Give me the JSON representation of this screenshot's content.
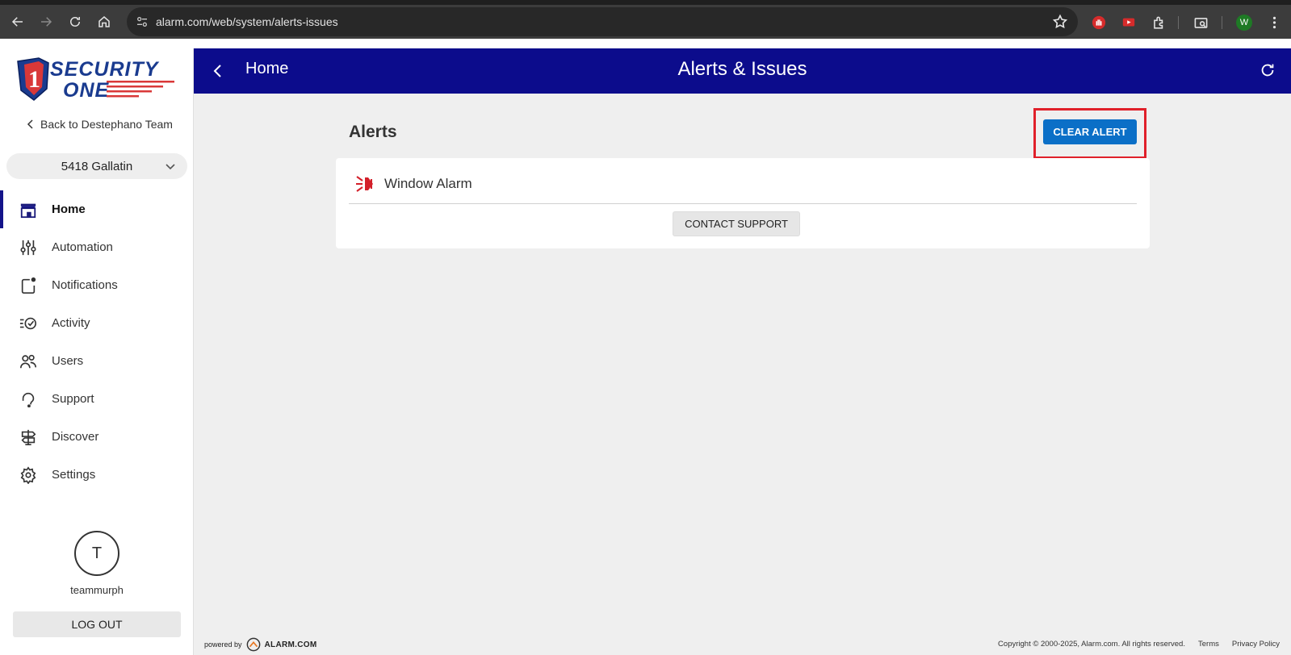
{
  "browser": {
    "url": "alarm.com/web/system/alerts-issues",
    "profile_initial": "W"
  },
  "sidebar": {
    "back_label": "Back to Destephano Team",
    "site_name": "5418 Gallatin",
    "items": [
      {
        "label": "Home",
        "icon": "home-icon",
        "active": true
      },
      {
        "label": "Automation",
        "icon": "sliders-icon"
      },
      {
        "label": "Notifications",
        "icon": "notification-icon"
      },
      {
        "label": "Activity",
        "icon": "activity-icon"
      },
      {
        "label": "Users",
        "icon": "users-icon"
      },
      {
        "label": "Support",
        "icon": "headset-icon"
      },
      {
        "label": "Discover",
        "icon": "signpost-icon"
      },
      {
        "label": "Settings",
        "icon": "gear-icon"
      }
    ],
    "user_initial": "T",
    "username": "teammurph",
    "logout_label": "LOG OUT"
  },
  "header": {
    "back_label": "Home",
    "title": "Alerts & Issues"
  },
  "main": {
    "section_title": "Alerts",
    "clear_label": "CLEAR ALERT",
    "alert_label": "Window Alarm",
    "support_label": "CONTACT SUPPORT"
  },
  "footer": {
    "powered_by": "powered by",
    "brand": "ALARM.COM",
    "copyright": "Copyright © 2000-2025, Alarm.com. All rights reserved.",
    "terms": "Terms",
    "privacy": "Privacy Policy"
  },
  "colors": {
    "header_bg": "#0c0c8c",
    "primary_button": "#0b6fc7",
    "highlight_box": "#e0202a",
    "alarm_icon": "#d3202a"
  }
}
